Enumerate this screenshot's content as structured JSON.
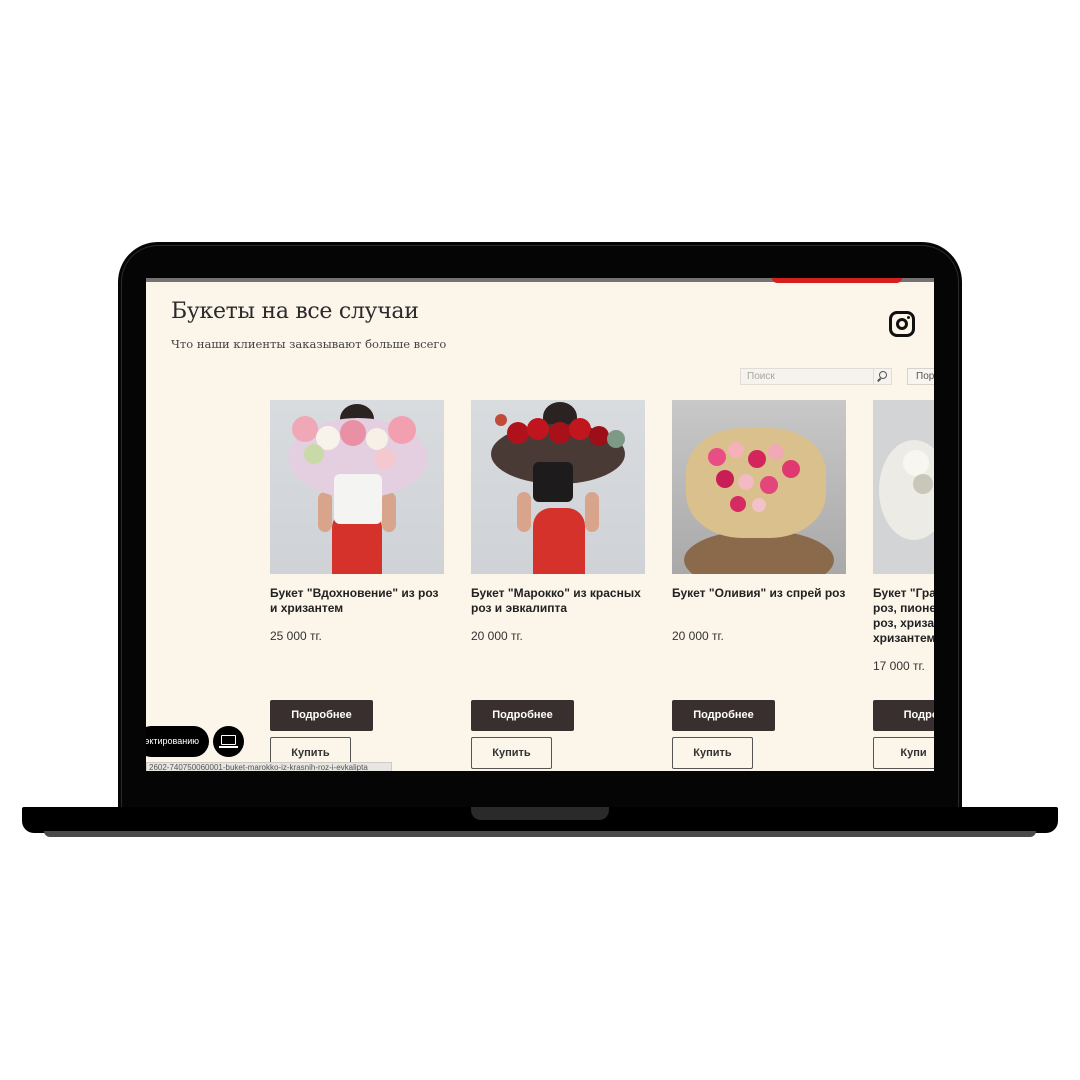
{
  "page": {
    "title": "Букеты на все случаи",
    "subtitle": "Что наши клиенты заказывают больше всего"
  },
  "search": {
    "placeholder": "Поиск"
  },
  "sort": {
    "label": "Пор"
  },
  "products": [
    {
      "name": "Букет \"Вдохновение\" из роз и хризантем",
      "price": "25 000 тг.",
      "more_label": "Подробнее",
      "buy_label": "Купить"
    },
    {
      "name": "Букет \"Марокко\" из красных роз и эвкалипта",
      "price": "20 000 тг.",
      "more_label": "Подробнее",
      "buy_label": "Купить"
    },
    {
      "name": "Букет \"Оливия\" из спрей роз",
      "price": "20 000 тг.",
      "more_label": "Подробнее",
      "buy_label": "Купить"
    },
    {
      "name": "Букет \"Гра\nроз, пионе\nроз, хриза\nхризантем",
      "price": "17 000 тг.",
      "more_label": "Подроб",
      "buy_label": "Купи"
    }
  ],
  "widgets": {
    "pill_label": "эктированию",
    "status_url": "2602-740750060001-buket-marokko-iz-krasnih-roz-i-evkalipta"
  },
  "icons": [
    "instagram-icon",
    "search-icon",
    "laptop-icon"
  ],
  "colors": {
    "page_bg": "#fbf5ea",
    "button_dark": "#3a2f2f",
    "text": "#222222"
  }
}
